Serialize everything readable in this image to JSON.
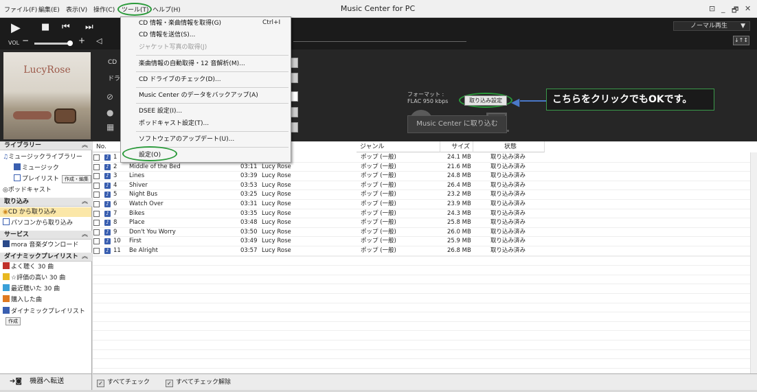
{
  "menubar": {
    "items": [
      "ファイル(F)",
      "編集(E)",
      "表示(V)",
      "操作(C)",
      "ツール(T)",
      "ヘルプ(H)"
    ],
    "app_title": "Music Center for PC",
    "window_controls": [
      "⊡",
      "_",
      "🗗",
      "✕"
    ]
  },
  "player": {
    "vol_label": "VOL",
    "play_mode": "ノーマル再生",
    "sort_label": "↓↑↕"
  },
  "cd_panel": {
    "album_text": "LucyRose",
    "cd_label": "CD",
    "drive_label": "ドラ",
    "format_label": "フォーマット :",
    "format_value": "FLAC 950 kbps",
    "import_settings_button": "取り込み設定",
    "import_button": "Music Center に取り込む",
    "callout_text": "こちらをクリックでもOKです。"
  },
  "tools_menu": {
    "items": [
      {
        "label": "CD 情報・楽曲情報を取得(G)",
        "shortcut": "Ctrl+I",
        "disabled": false
      },
      {
        "label": "CD 情報を送信(S)...",
        "shortcut": "",
        "disabled": false
      },
      {
        "label": "ジャケット写真の取得(J)",
        "shortcut": "",
        "disabled": true
      },
      {
        "label": "楽曲情報の自動取得・12 音解析(M)...",
        "shortcut": "",
        "disabled": false
      },
      {
        "label": "CD ドライブのチェック(D)...",
        "shortcut": "",
        "disabled": false
      },
      {
        "label": "Music Center のデータをバックアップ(A)",
        "shortcut": "",
        "disabled": false
      },
      {
        "label": "DSEE 設定(I)...",
        "shortcut": "",
        "disabled": false
      },
      {
        "label": "ポッドキャスト設定(T)...",
        "shortcut": "",
        "disabled": false
      },
      {
        "label": "ソフトウェアのアップデート(U)...",
        "shortcut": "",
        "disabled": false
      },
      {
        "label": "設定(O)",
        "shortcut": "",
        "disabled": false
      }
    ]
  },
  "sidebar": {
    "library_header": "ライブラリー",
    "music_library": "ミュージックライブラリー",
    "music": "ミュージック",
    "playlist": "プレイリスト",
    "playlist_btn": "作成・編集",
    "podcast": "ポッドキャスト",
    "import_header": "取り込み",
    "import_cd": "CD から取り込み",
    "import_pc": "パソコンから取り込み",
    "service_header": "サービス",
    "mora": "mora 音楽ダウンロード",
    "dynamic_header": "ダイナミックプレイリスト",
    "dyn_items": [
      "よく聴く 30 曲",
      "☆評価の高い 30 曲",
      "最近聴いた 30 曲",
      "購入した曲"
    ],
    "dyn_playlist": "ダイナミックプレイリスト",
    "dyn_playlist_btn": "作成",
    "transfer": "機器へ転送"
  },
  "tracklist": {
    "headers": {
      "no": "No.",
      "genre": "ジャンル",
      "size": "サイズ",
      "status": "状態"
    },
    "tracks": [
      {
        "no": "1",
        "title": "",
        "time": "",
        "artist": "",
        "genre": "ポップ (一般)",
        "size": "24.1 MB",
        "status": "取り込み済み"
      },
      {
        "no": "2",
        "title": "Middle of the Bed",
        "time": "03:11",
        "artist": "Lucy Rose",
        "genre": "ポップ (一般)",
        "size": "21.6 MB",
        "status": "取り込み済み"
      },
      {
        "no": "3",
        "title": "Lines",
        "time": "03:39",
        "artist": "Lucy Rose",
        "genre": "ポップ (一般)",
        "size": "24.8 MB",
        "status": "取り込み済み"
      },
      {
        "no": "4",
        "title": "Shiver",
        "time": "03:53",
        "artist": "Lucy Rose",
        "genre": "ポップ (一般)",
        "size": "26.4 MB",
        "status": "取り込み済み"
      },
      {
        "no": "5",
        "title": "Night Bus",
        "time": "03:25",
        "artist": "Lucy Rose",
        "genre": "ポップ (一般)",
        "size": "23.2 MB",
        "status": "取り込み済み"
      },
      {
        "no": "6",
        "title": "Watch Over",
        "time": "03:31",
        "artist": "Lucy Rose",
        "genre": "ポップ (一般)",
        "size": "23.9 MB",
        "status": "取り込み済み"
      },
      {
        "no": "7",
        "title": "Bikes",
        "time": "03:35",
        "artist": "Lucy Rose",
        "genre": "ポップ (一般)",
        "size": "24.3 MB",
        "status": "取り込み済み"
      },
      {
        "no": "8",
        "title": "Place",
        "time": "03:48",
        "artist": "Lucy Rose",
        "genre": "ポップ (一般)",
        "size": "25.8 MB",
        "status": "取り込み済み"
      },
      {
        "no": "9",
        "title": "Don't You Worry",
        "time": "03:50",
        "artist": "Lucy Rose",
        "genre": "ポップ (一般)",
        "size": "26.0 MB",
        "status": "取り込み済み"
      },
      {
        "no": "10",
        "title": "First",
        "time": "03:49",
        "artist": "Lucy Rose",
        "genre": "ポップ (一般)",
        "size": "25.9 MB",
        "status": "取り込み済み"
      },
      {
        "no": "11",
        "title": "Be Alright",
        "time": "03:57",
        "artist": "Lucy Rose",
        "genre": "ポップ (一般)",
        "size": "26.8 MB",
        "status": "取り込み済み"
      }
    ]
  },
  "bottombar": {
    "check_all": "すべてチェック",
    "uncheck_all": "すべてチェック解除"
  },
  "colors": {
    "accent_green": "#2a9a3a",
    "arrow_blue": "#4a78c8",
    "selected": "#fbe7a8"
  }
}
